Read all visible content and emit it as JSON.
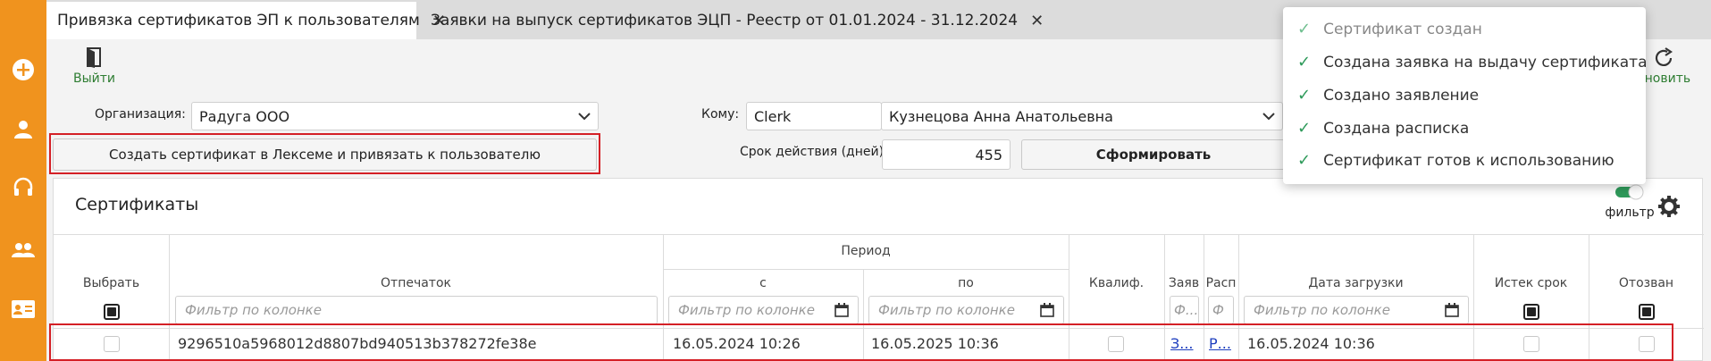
{
  "sidebar": {
    "icons": [
      "plus-circle-icon",
      "user-icon",
      "headset-icon",
      "users-icon",
      "id-card-icon"
    ]
  },
  "tabs": [
    {
      "label": "Привязка сертификатов ЭП к пользователям",
      "active": true
    },
    {
      "label": "Заявки на выпуск сертификатов ЭЦП - Реестр от 01.01.2024 - 31.12.2024",
      "active": false
    }
  ],
  "toolbar": {
    "exit_label": "Выйти",
    "refresh_label": "бновить"
  },
  "form": {
    "org_label": "Организация:",
    "org_value": "Радуга ООО",
    "to_label": "Кому:",
    "to_login": "Clerk",
    "to_name": "Кузнецова Анна Анатольевна",
    "create_button": "Создать сертификат в Лексеме и привязать к пользователю",
    "validity_label": "Срок действия (дней)",
    "validity_value": "455",
    "generate_button": "Сформировать"
  },
  "panel": {
    "title": "Сертификаты",
    "filter_toggle_label": "фильтр",
    "filter_on": true
  },
  "table": {
    "period_header": "Период",
    "headers": {
      "select": "Выбрать",
      "thumbprint": "Отпечаток",
      "from": "с",
      "to": "по",
      "qualified": "Квалиф.",
      "request": "Заяв",
      "receipt": "Расп",
      "upload_date": "Дата загрузки",
      "expired": "Истек срок",
      "revoked": "Отозван"
    },
    "filter_placeholder": "Фильтр по колонке",
    "filter_short": "Ф...",
    "filter_short2": "Ф",
    "rows": [
      {
        "thumbprint": "9296510a5968012d8807bd940513b378272fe38e",
        "from": "16.05.2024 10:26",
        "to": "16.05.2025 10:36",
        "request_link": "З...",
        "receipt_link": "Р...",
        "upload_date": "16.05.2024 10:36"
      }
    ]
  },
  "popup": {
    "items": [
      "Сертификат создан",
      "Создана заявка на выдачу сертификата",
      "Создано заявление",
      "Создана расписка",
      "Сертификат готов к использованию"
    ]
  },
  "colors": {
    "sidebar": "#f0931e",
    "accent_green": "#2e7d32",
    "highlight_red": "#d42026",
    "link_blue": "#1f3fbf"
  }
}
